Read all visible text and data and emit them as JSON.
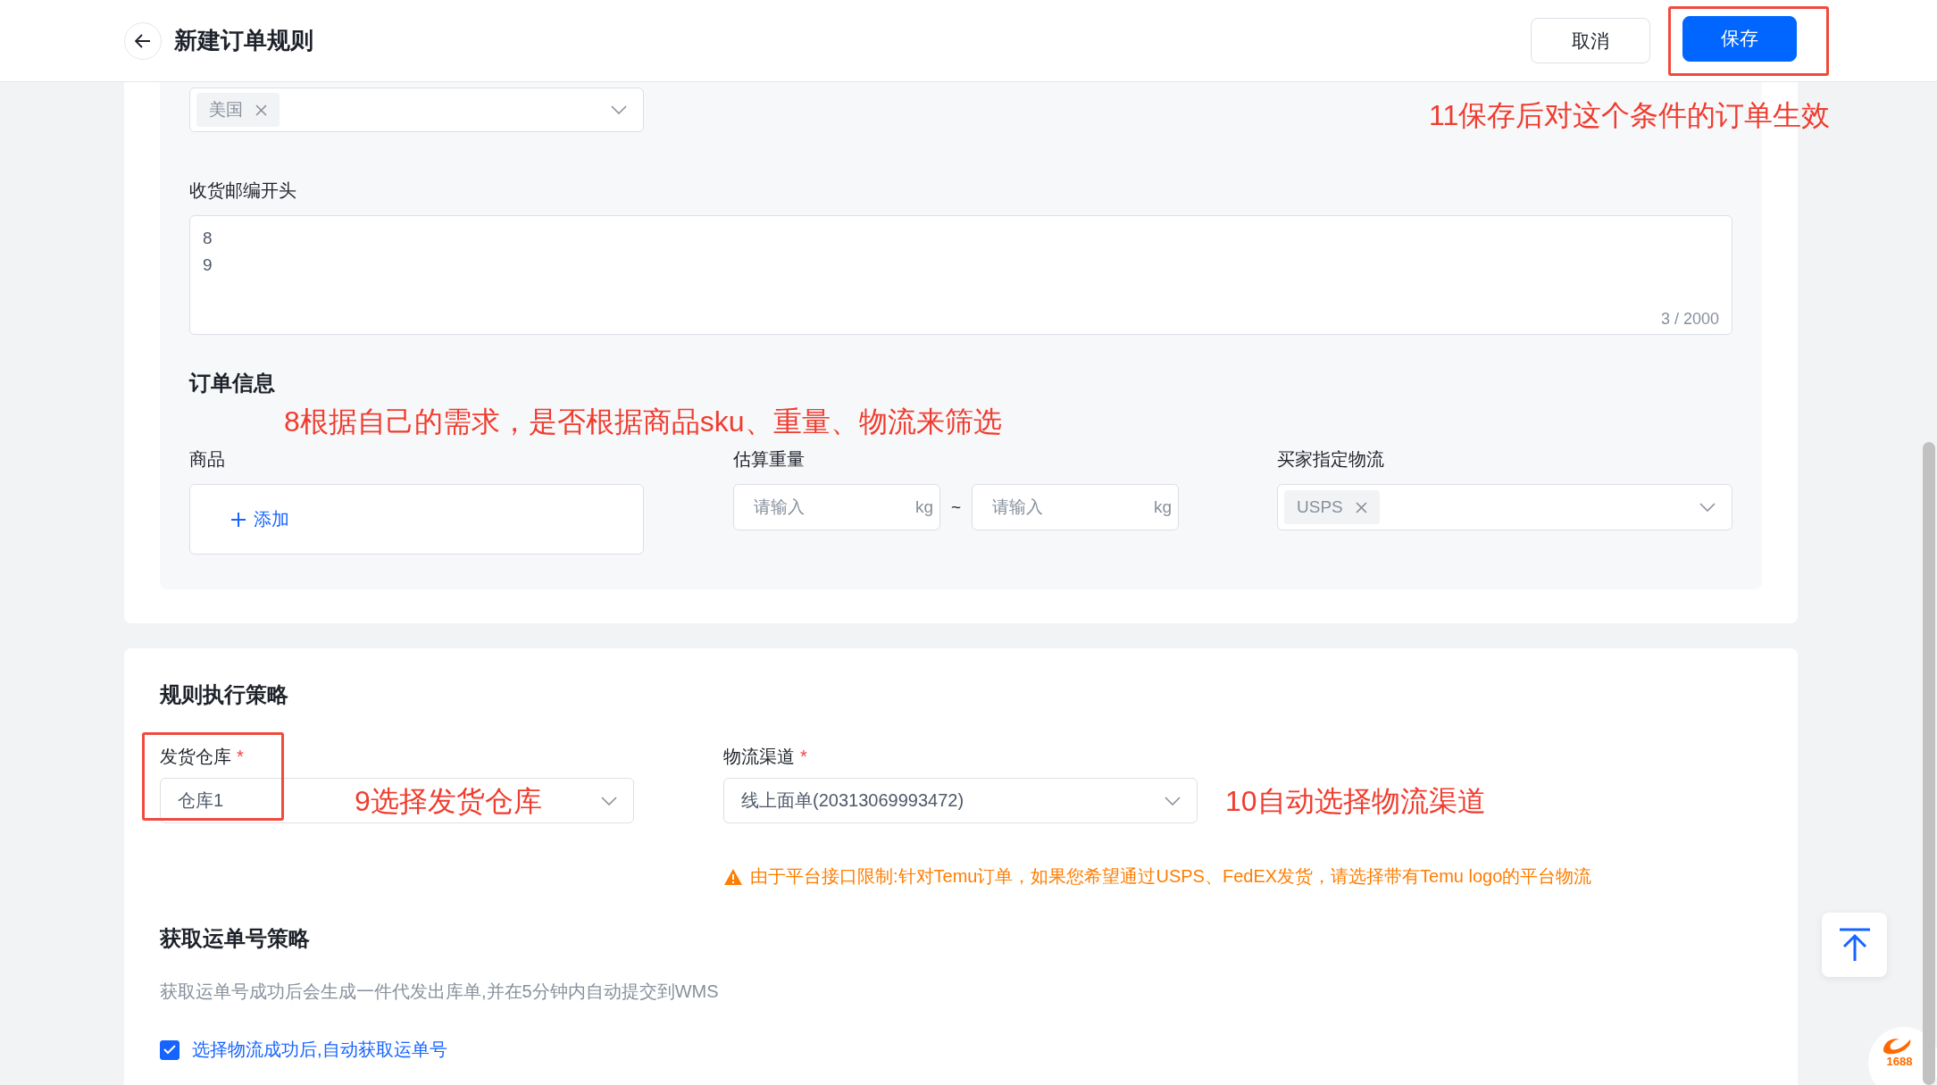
{
  "header": {
    "title": "新建订单规则",
    "buttons": [
      {
        "label": "取消",
        "kind": "secondary",
        "highlighted": false
      },
      {
        "label": "保存",
        "kind": "primary",
        "highlighted": true
      }
    ],
    "annotation": "11保存后对这个条件的订单生效"
  },
  "region": {
    "country_select": {
      "tags": [
        "美国"
      ]
    },
    "postcode": {
      "label": "收货邮编开头",
      "lines": [
        "8",
        "9"
      ],
      "counter": "3 / 2000"
    }
  },
  "order_info": {
    "title": "订单信息",
    "annotation": "8根据自己的需求，是否根据商品sku、重量、物流来筛选",
    "product": {
      "label": "商品",
      "add": "添加"
    },
    "weight": {
      "label": "估算重量",
      "separator": "~",
      "inputs": [
        {
          "placeholder": "请输入",
          "unit": "kg"
        },
        {
          "placeholder": "请输入",
          "unit": "kg"
        }
      ]
    },
    "buyer_logistics": {
      "label": "买家指定物流",
      "tags": [
        "USPS"
      ]
    }
  },
  "strategy": {
    "title": "规则执行策略",
    "warehouse": {
      "label": "发货仓库",
      "required_mark": "*",
      "value": "仓库1",
      "highlighted": true,
      "annotation": "9选择发货仓库"
    },
    "channel": {
      "label": "物流渠道",
      "required_mark": "*",
      "value": "线上面单(20313069993472)",
      "annotation": "10自动选择物流渠道"
    },
    "warning": "由于平台接口限制:针对Temu订单，如果您希望通过USPS、FedEX发货，请选择带有Temu logo的平台物流"
  },
  "tracking": {
    "title": "获取运单号策略",
    "description": "获取运单号成功后会生成一件代发出库单,并在5分钟内自动提交到WMS",
    "checkbox": {
      "label": "选择物流成功后,自动获取运单号",
      "checked": true
    }
  },
  "corner_badge": {
    "text": "1688"
  }
}
